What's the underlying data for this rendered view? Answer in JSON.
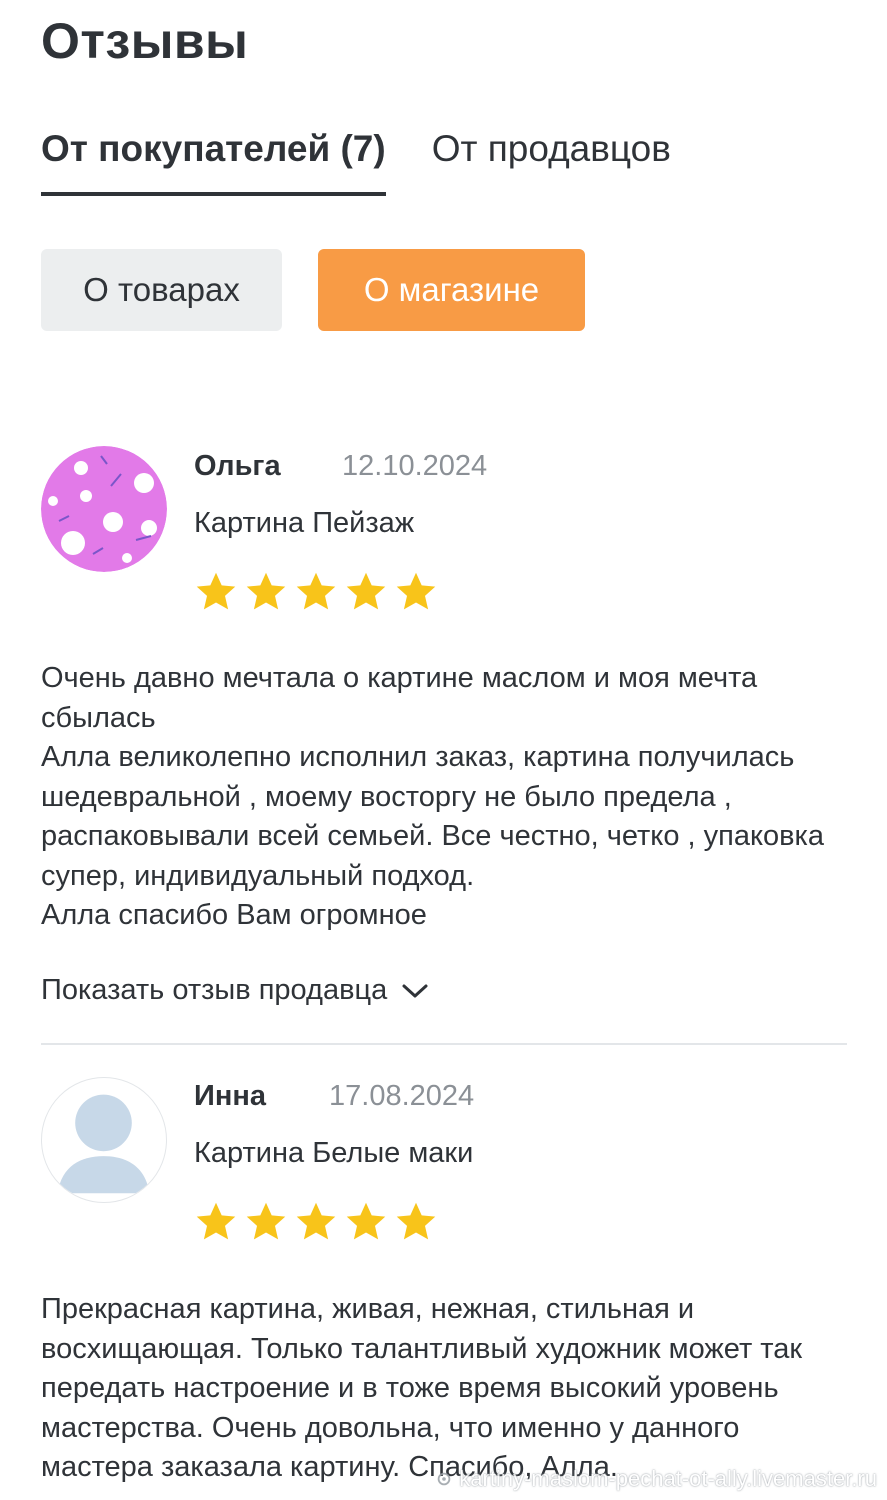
{
  "page": {
    "title": "Отзывы"
  },
  "tabs": [
    {
      "label": "От покупателей (7)",
      "active": true
    },
    {
      "label": "От продавцов",
      "active": false
    }
  ],
  "filters": [
    {
      "label": "О товарах",
      "active": false
    },
    {
      "label": "О магазине",
      "active": true
    }
  ],
  "colors": {
    "accent": "#f89b45",
    "star": "#f8c41a",
    "text": "#2f3338",
    "muted": "#8b9096",
    "avatar_purple": "#e27ae8",
    "avatar_blank": "#c7d8e8"
  },
  "reviews": [
    {
      "author": "Ольга",
      "date": "12.10.2024",
      "product": "Картина Пейзаж",
      "rating": 5,
      "avatar": "pattern-avatar-icon",
      "text": "Очень давно мечтала о картине маслом и моя мечта сбылась\nАлла великолепно исполнил заказ, картина получилась шедевральной , моему восторгу не было предела , распаковывали всей семьей. Все честно, четко , упаковка супер, индивидуальный подход.\nАлла спасибо Вам огромное",
      "show_seller_label": "Показать отзыв продавца"
    },
    {
      "author": "Инна",
      "date": "17.08.2024",
      "product": "Картина Белые маки",
      "rating": 5,
      "avatar": "default-user-icon",
      "text": "Прекрасная картина, живая, нежная, стильная и восхищающая. Только талантливый художник может так передать настроение и в тоже время высокий уровень мастерства. Очень довольна, что именно у данного мастера заказала картину. Спасибо, Алла."
    }
  ],
  "watermark": "kartiny-maslom-pechat-ot-ally.livemaster.ru"
}
